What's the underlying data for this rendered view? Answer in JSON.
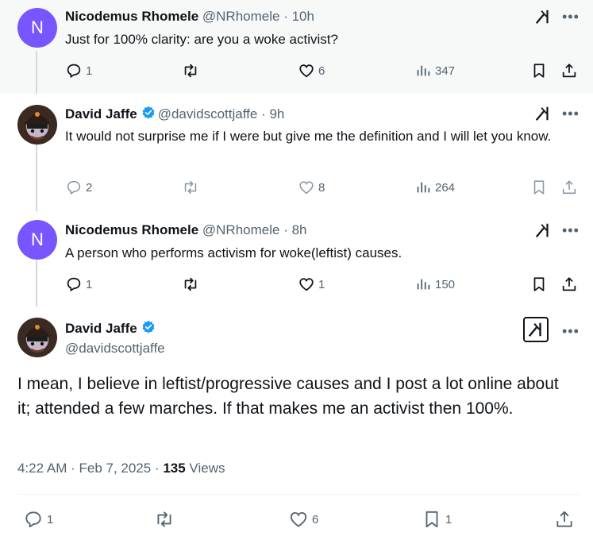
{
  "tweets": [
    {
      "name": "Nicodemus Rhomele",
      "handle": "@NRhomele",
      "time": "10h",
      "text": "Just for 100% clarity: are you a woke activist?",
      "avatar_letter": "N",
      "replies": "1",
      "likes": "6",
      "views": "347"
    },
    {
      "name": "David Jaffe",
      "handle": "@davidscottjaffe",
      "time": "9h",
      "text": "It would not surprise me if I were but give me the definition and I will let you know.",
      "replies": "2",
      "likes": "8",
      "views": "264"
    },
    {
      "name": "Nicodemus Rhomele",
      "handle": "@NRhomele",
      "time": "8h",
      "text": "A person who performs activism for woke(leftist) causes.",
      "avatar_letter": "N",
      "replies": "1",
      "likes": "1",
      "views": "150"
    }
  ],
  "main": {
    "name": "David Jaffe",
    "handle": "@davidscottjaffe",
    "text": "I mean, I believe in leftist/progressive causes and I post a lot online about it; attended a few marches. If that makes me an activist then 100%.",
    "timestamp": "4:22 AM · Feb 7, 2025 · ",
    "views_count": "135",
    "views_label": " Views",
    "replies": "1",
    "likes": "6",
    "bookmarks": "1"
  },
  "separator": " · ",
  "more_glyph": "•••",
  "colors": {
    "accent": "#1d9bf0",
    "avatar_purple": "#7856ff",
    "muted": "#536471",
    "text": "#0f1419"
  },
  "icons": [
    "reply-icon",
    "retweet-icon",
    "like-icon",
    "views-icon",
    "bookmark-icon",
    "share-icon",
    "grok-icon",
    "more-icon",
    "verified-icon"
  ]
}
